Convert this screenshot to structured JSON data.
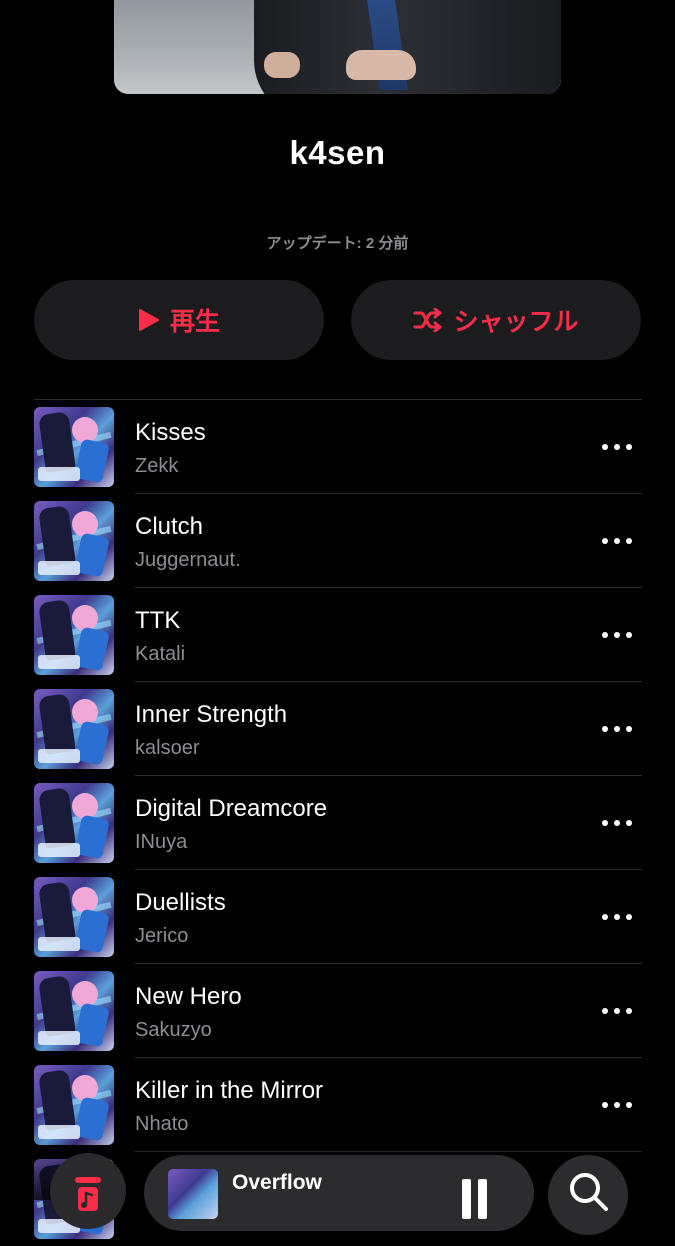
{
  "playlist": {
    "title": "k4sen",
    "updated": "アップデート: 2 分前"
  },
  "actions": {
    "play_label": "再生",
    "shuffle_label": "シャッフル",
    "accent": "#fa2d48"
  },
  "tracks": [
    {
      "title": "Kisses",
      "artist": "Zekk"
    },
    {
      "title": "Clutch",
      "artist": "Juggernaut."
    },
    {
      "title": "TTK",
      "artist": "Katali"
    },
    {
      "title": "Inner Strength",
      "artist": "kalsoer"
    },
    {
      "title": "Digital Dreamcore",
      "artist": "INuya"
    },
    {
      "title": "Duellists",
      "artist": "Jerico"
    },
    {
      "title": "New Hero",
      "artist": "Sakuzyo"
    },
    {
      "title": "Killer in the Mirror",
      "artist": "Nhato"
    }
  ],
  "mini_player": {
    "title": "Overflow",
    "state_icon": "pause-icon"
  },
  "icons": {
    "play": "play-icon",
    "shuffle": "shuffle-icon",
    "more": "more-icon",
    "library": "music-note-icon",
    "search": "search-icon"
  }
}
